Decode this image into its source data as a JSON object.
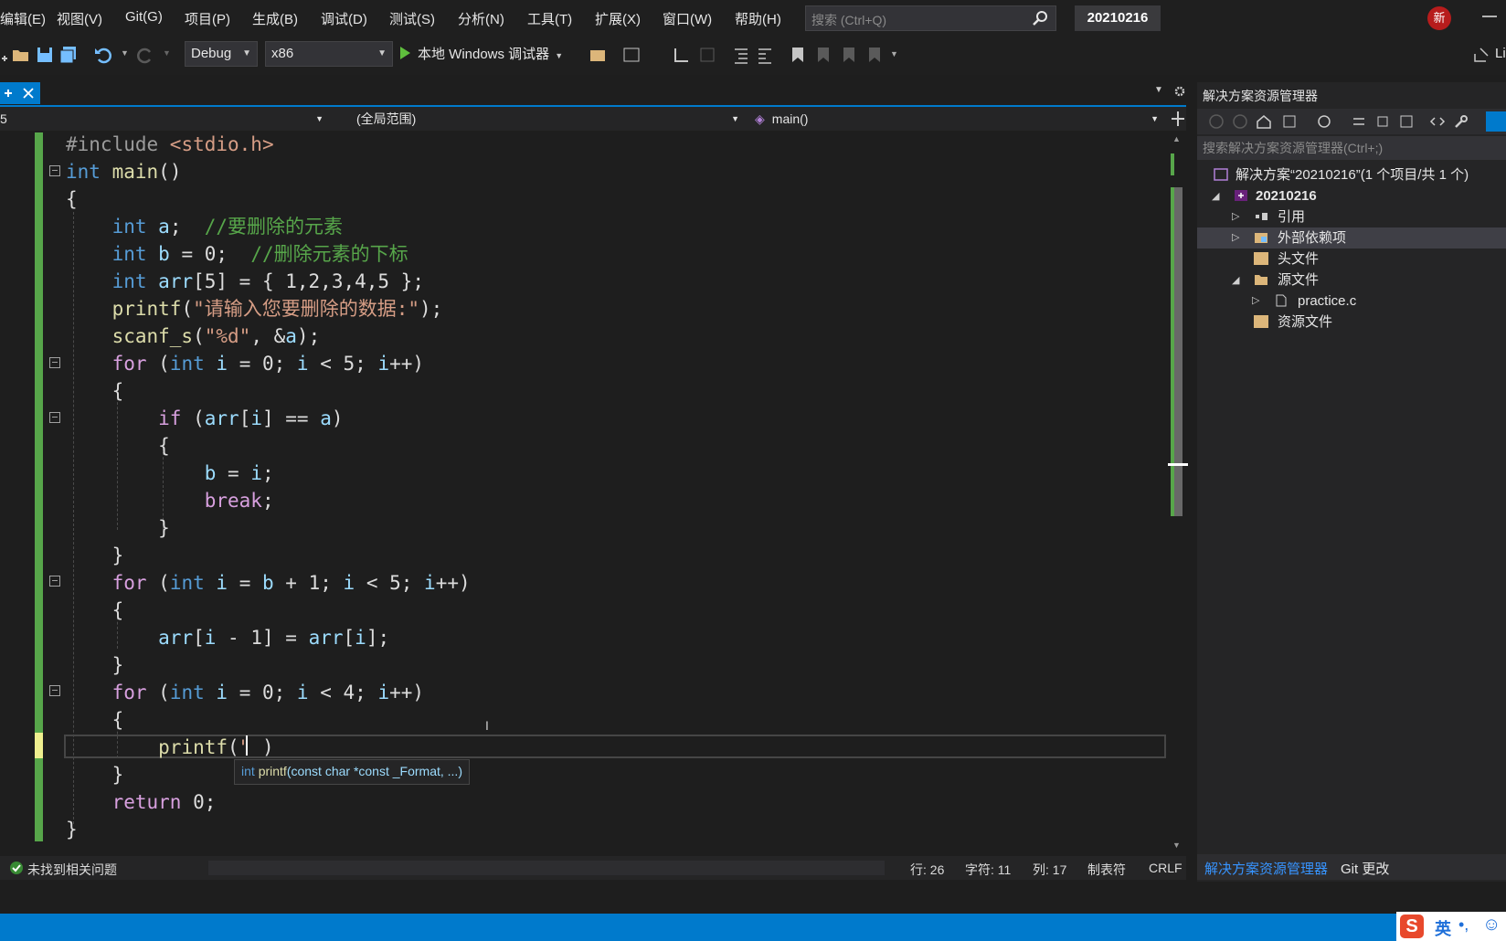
{
  "menubar": {
    "items": [
      "编辑(E)",
      "视图(V)",
      "Git(G)",
      "项目(P)",
      "生成(B)",
      "调试(D)",
      "测试(S)",
      "分析(N)",
      "工具(T)",
      "扩展(X)",
      "窗口(W)",
      "帮助(H)"
    ],
    "search_placeholder": "搜索 (Ctrl+Q)",
    "project_title": "20210216",
    "avatar_text": "新"
  },
  "toolbar": {
    "config": "Debug",
    "platform": "x86",
    "run_label": "本地 Windows 调试器",
    "liveshare_label": "Li"
  },
  "navbar": {
    "left": "5",
    "scope": "(全局范围)",
    "member": "main()"
  },
  "editor": {
    "tooltip": {
      "ret": "int",
      "fn": "printf",
      "params": "(const char *const _Format, ...)"
    }
  },
  "status": {
    "issues": "未找到相关问题",
    "line": "行: 26",
    "char": "字符: 11",
    "col": "列: 17",
    "tabs": "制表符",
    "eol": "CRLF"
  },
  "solution_explorer": {
    "title": "解决方案资源管理器",
    "search": "搜索解决方案资源管理器(Ctrl+;)",
    "solution": "解决方案“20210216”(1 个项目/共 1 个)",
    "project": "20210216",
    "references": "引用",
    "external_deps": "外部依赖项",
    "headers": "头文件",
    "sources": "源文件",
    "source_file": "practice.c",
    "resources": "资源文件",
    "tab_se": "解决方案资源管理器",
    "tab_git": "Git 更改"
  },
  "ime": {
    "lang": "英"
  },
  "colors": {
    "accent": "#007acc",
    "keyword": "#569cd6",
    "comment": "#57a64a",
    "string": "#d69d85"
  }
}
